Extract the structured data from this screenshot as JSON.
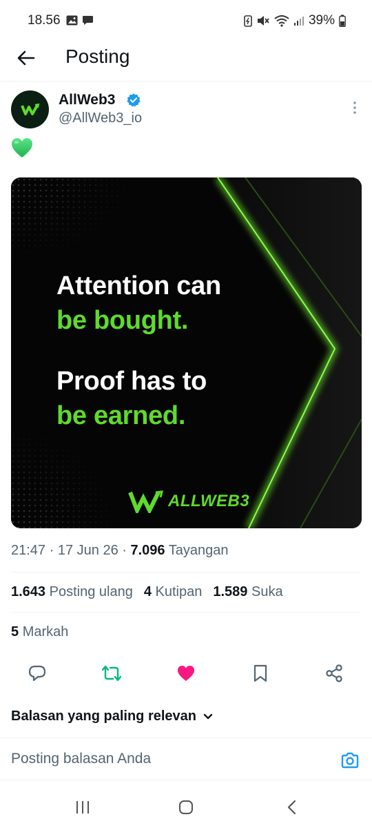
{
  "status_bar": {
    "time": "18.56",
    "battery": "39%"
  },
  "header": {
    "title": "Posting"
  },
  "author": {
    "name": "AllWeb3",
    "handle": "@AllWeb3_io"
  },
  "tweet": {
    "emoji": "💚",
    "media": {
      "line1": "Attention can",
      "line2": "be bought.",
      "line3": "Proof has to",
      "line4": "be earned.",
      "logo_text": "ALLWEB3"
    }
  },
  "meta": {
    "time": "21:47",
    "date": "17 Jun 26",
    "views_count": "7.096",
    "views_label": "Tayangan"
  },
  "stats": {
    "reposts_count": "1.643",
    "reposts_label": "Posting ulang",
    "quotes_count": "4",
    "quotes_label": "Kutipan",
    "likes_count": "1.589",
    "likes_label": "Suka",
    "bookmarks_count": "5",
    "bookmarks_label": "Markah"
  },
  "replies": {
    "filter_label": "Balasan yang paling relevan"
  },
  "reply_bar": {
    "placeholder": "Posting balasan Anda"
  },
  "colors": {
    "accent": "#1d9bf0",
    "like": "#f91880",
    "repost": "#00ba7c",
    "brand_green": "#5edb2c"
  },
  "icons": [
    "back-arrow-icon",
    "verified-badge-icon",
    "more-vertical-icon",
    "reply-icon",
    "repost-icon",
    "like-icon",
    "bookmark-icon",
    "share-icon",
    "chevron-down-icon",
    "camera-icon",
    "recent-apps-icon",
    "home-icon",
    "back-icon"
  ]
}
